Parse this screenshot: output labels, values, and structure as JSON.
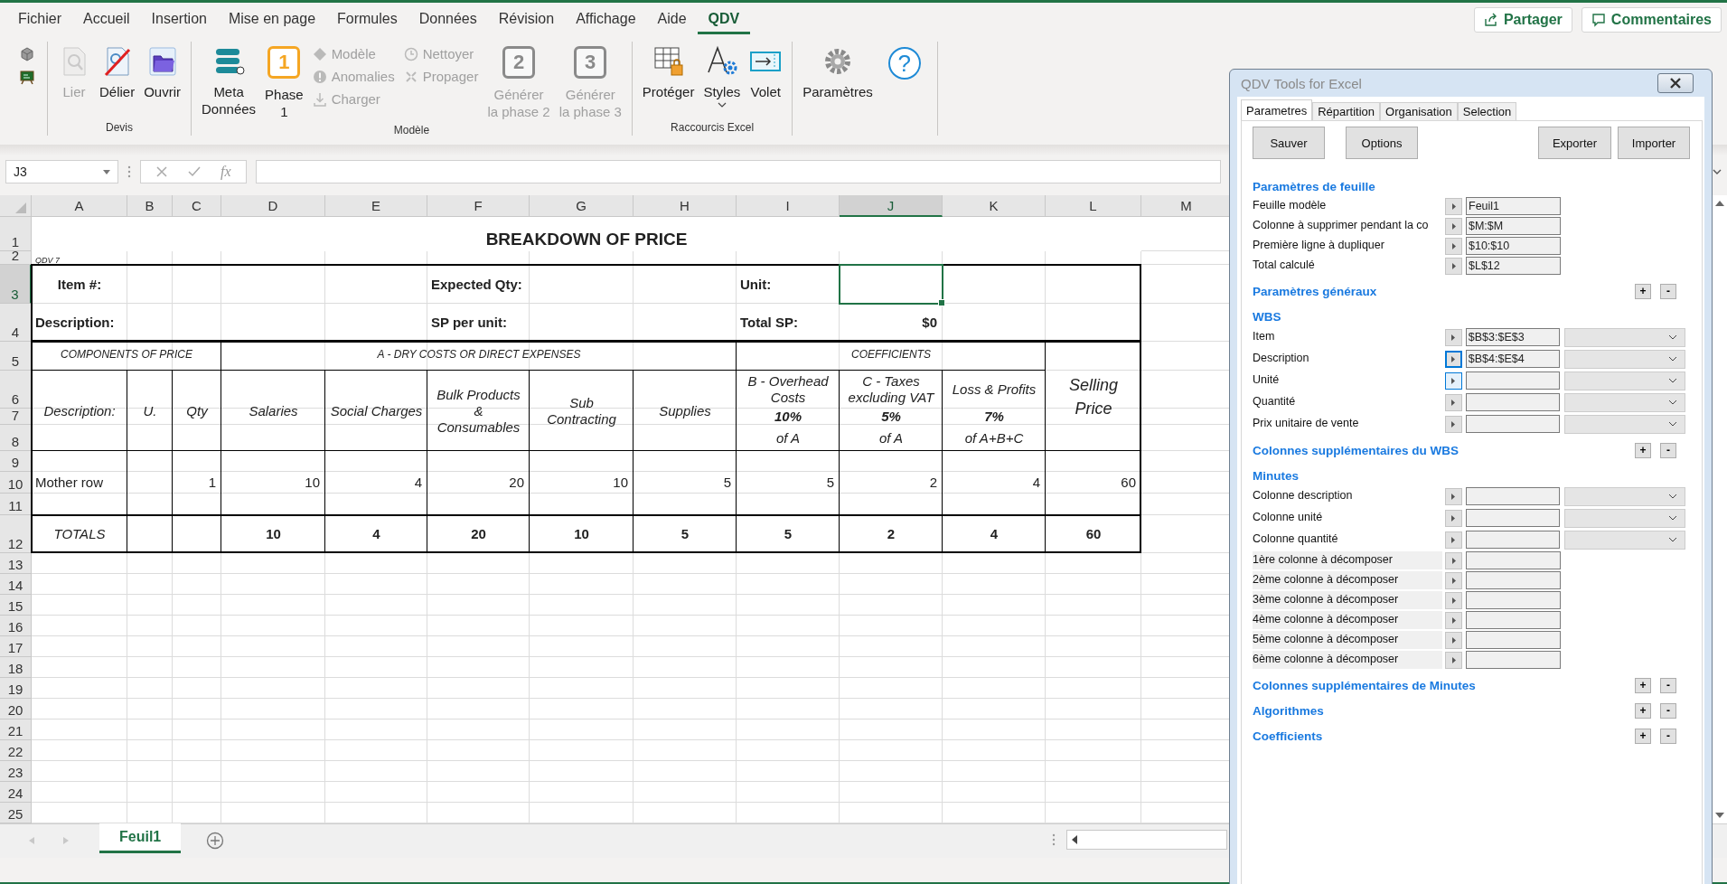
{
  "app_tabs": [
    {
      "label": "Fichier",
      "selected": false
    },
    {
      "label": "Accueil",
      "selected": false
    },
    {
      "label": "Insertion",
      "selected": false
    },
    {
      "label": "Mise en page",
      "selected": false
    },
    {
      "label": "Formules",
      "selected": false
    },
    {
      "label": "Données",
      "selected": false
    },
    {
      "label": "Révision",
      "selected": false
    },
    {
      "label": "Affichage",
      "selected": false
    },
    {
      "label": "Aide",
      "selected": false
    },
    {
      "label": "QDV",
      "selected": true
    }
  ],
  "share_button": "Partager",
  "comments_button": "Commentaires",
  "ribbon": {
    "groups": [
      {
        "label": "Devis",
        "columns": [
          {
            "kind": "large",
            "label": "Lier",
            "disabled": true,
            "menu": false
          },
          {
            "kind": "large",
            "label": "Délier",
            "disabled": false,
            "menu": false
          },
          {
            "kind": "large",
            "label": "Ouvrir",
            "disabled": false,
            "menu": false
          }
        ]
      },
      {
        "label": "Modèle",
        "columns": [
          {
            "kind": "large",
            "label": "Meta\nDonnées",
            "disabled": false,
            "menu": false
          },
          {
            "kind": "large",
            "label": "Phase\n1",
            "badge": "1",
            "disabled": false,
            "menu": false
          },
          {
            "kind": "stack",
            "items": [
              {
                "label": "Modèle",
                "disabled": true
              },
              {
                "label": "Anomalies",
                "disabled": true
              },
              {
                "label": "Charger",
                "disabled": true
              }
            ]
          },
          {
            "kind": "stack",
            "items": [
              {
                "label": "Nettoyer",
                "disabled": true
              },
              {
                "label": "Propager",
                "disabled": true
              }
            ]
          },
          {
            "kind": "large",
            "label": "Générer\nla phase 2",
            "badge": "2",
            "disabled": true,
            "menu": false
          },
          {
            "kind": "large",
            "label": "Générer\nla phase 3",
            "badge": "3",
            "disabled": true,
            "menu": false
          }
        ]
      },
      {
        "label": "Raccourcis Excel",
        "columns": [
          {
            "kind": "large",
            "label": "Protéger",
            "disabled": false,
            "menu": false
          },
          {
            "kind": "large",
            "label": "Styles",
            "disabled": false,
            "menu": true
          },
          {
            "kind": "large",
            "label": "Volet",
            "disabled": false,
            "menu": false
          }
        ]
      },
      {
        "columns": [
          {
            "kind": "large",
            "label": "Paramètres",
            "disabled": false,
            "menu": false
          },
          {
            "kind": "help",
            "glyph": "?"
          }
        ]
      }
    ]
  },
  "formula_bar": {
    "name_box": "J3",
    "function_glyph": "fx"
  },
  "sheet": {
    "columns": [
      {
        "label": "A",
        "selected": false
      },
      {
        "label": "B",
        "selected": false
      },
      {
        "label": "C",
        "selected": false
      },
      {
        "label": "D",
        "selected": false
      },
      {
        "label": "E",
        "selected": false
      },
      {
        "label": "F",
        "selected": false
      },
      {
        "label": "G",
        "selected": false
      },
      {
        "label": "H",
        "selected": false
      },
      {
        "label": "I",
        "selected": false
      },
      {
        "label": "J",
        "selected": true
      },
      {
        "label": "K",
        "selected": false
      },
      {
        "label": "L",
        "selected": false
      },
      {
        "label": "M",
        "selected": false
      }
    ],
    "rows": [
      {
        "label": "1",
        "selected": false
      },
      {
        "label": "2",
        "selected": false
      },
      {
        "label": "3",
        "selected": true
      },
      {
        "label": "4",
        "selected": false
      },
      {
        "label": "5",
        "selected": false
      },
      {
        "label": "6",
        "selected": false
      },
      {
        "label": "7",
        "selected": false
      },
      {
        "label": "8",
        "selected": false
      },
      {
        "label": "9",
        "selected": false
      },
      {
        "label": "10",
        "selected": false
      },
      {
        "label": "11",
        "selected": false
      },
      {
        "label": "12",
        "selected": false
      },
      {
        "label": "13",
        "selected": false
      },
      {
        "label": "14",
        "selected": false
      },
      {
        "label": "15",
        "selected": false
      },
      {
        "label": "16",
        "selected": false
      },
      {
        "label": "17",
        "selected": false
      },
      {
        "label": "18",
        "selected": false
      },
      {
        "label": "19",
        "selected": false
      },
      {
        "label": "20",
        "selected": false
      },
      {
        "label": "21",
        "selected": false
      },
      {
        "label": "22",
        "selected": false
      },
      {
        "label": "23",
        "selected": false
      },
      {
        "label": "24",
        "selected": false
      },
      {
        "label": "25",
        "selected": false
      }
    ],
    "title": "BREAKDOWN OF PRICE",
    "version": "QDV 7",
    "info_labels": [
      "Item #:",
      "Expected Qty:",
      "Unit:",
      "Description:",
      "SP per unit:",
      "Total SP:"
    ],
    "total_sp": "$0",
    "groups": [
      "COMPONENTS OF PRICE",
      "A - DRY COSTS OR DIRECT EXPENSES",
      "COEFFICIENTS"
    ],
    "selling_price": "Selling\nPrice",
    "headers": [
      "Description:",
      "U.",
      "Qty",
      "Salaries",
      "Social Charges",
      "Bulk Products\n&\nConsumables",
      "Sub\nContracting",
      "Supplies",
      "B - Overhead\nCosts",
      "C - Taxes\nexcluding VAT",
      "Loss & Profits"
    ],
    "rates": [
      {
        "rate": "10%",
        "basis": "of A"
      },
      {
        "rate": "5%",
        "basis": "of A"
      },
      {
        "rate": "7%",
        "basis": "of A+B+C"
      }
    ],
    "data_row": {
      "description": "Mother row",
      "qty": "1",
      "values": [
        "10",
        "4",
        "20",
        "10",
        "5",
        "5",
        "2",
        "4",
        "60"
      ]
    },
    "totals": {
      "label": "TOTALS",
      "values": [
        "10",
        "4",
        "20",
        "10",
        "5",
        "5",
        "2",
        "4",
        "60"
      ]
    }
  },
  "sheet_tabs": [
    {
      "label": "Feuil1",
      "selected": true
    }
  ],
  "panel": {
    "title": "QDV Tools for Excel",
    "tabs": [
      {
        "label": "Parametres",
        "selected": true
      },
      {
        "label": "Répartition",
        "selected": false
      },
      {
        "label": "Organisation",
        "selected": false
      },
      {
        "label": "Selection",
        "selected": false
      }
    ],
    "buttons": [
      "Sauver",
      "Options",
      "Exporter",
      "Importer"
    ],
    "sections": [
      {
        "title": "Paramètres de feuille",
        "rows": [
          {
            "kind": "ref",
            "label": "Feuille modèle",
            "value": "Feuil1",
            "focused": false,
            "hovered": false
          },
          {
            "kind": "ref",
            "label": "Colonne à supprimer pendant la co",
            "value": "$M:$M",
            "focused": false,
            "hovered": false
          },
          {
            "kind": "ref",
            "label": "Première ligne à dupliquer",
            "value": "$10:$10",
            "focused": false,
            "hovered": false
          },
          {
            "kind": "ref",
            "label": "Total calculé",
            "value": "$L$12",
            "focused": false,
            "hovered": false
          }
        ]
      },
      {
        "title": "Paramètres généraux",
        "buttons": [
          "+",
          "-"
        ]
      },
      {
        "title": "WBS",
        "rows": [
          {
            "kind": "ref-dropdown",
            "label": "Item",
            "value": "$B$3:$E$3",
            "focused": false,
            "hovered": false
          },
          {
            "kind": "ref-dropdown",
            "label": "Description",
            "value": "$B$4:$E$4",
            "focused": true,
            "hovered": false
          },
          {
            "kind": "ref-dropdown",
            "label": "Unité",
            "focused": false,
            "hovered": true
          },
          {
            "kind": "ref-dropdown",
            "label": "Quantité",
            "focused": false,
            "hovered": false
          },
          {
            "kind": "ref-dropdown",
            "label": "Prix unitaire de vente",
            "focused": false,
            "hovered": false
          }
        ]
      },
      {
        "title": "Colonnes supplémentaires du WBS",
        "buttons": [
          "+",
          "-"
        ]
      },
      {
        "title": "Minutes",
        "rows": [
          {
            "kind": "ref-dropdown",
            "label": "Colonne description",
            "focused": false,
            "hovered": false
          },
          {
            "kind": "ref-dropdown",
            "label": "Colonne unité",
            "focused": false,
            "hovered": false
          },
          {
            "kind": "ref-dropdown",
            "label": "Colonne quantité",
            "focused": false,
            "hovered": false
          },
          {
            "kind": "shaded",
            "label": "1ère colonne à décomposer",
            "focused": false,
            "hovered": false
          },
          {
            "kind": "shaded",
            "label": "2ème colonne à décomposer",
            "focused": false,
            "hovered": false
          },
          {
            "kind": "shaded",
            "label": "3ème colonne à décomposer",
            "focused": false,
            "hovered": false
          },
          {
            "kind": "shaded",
            "label": "4ème colonne à décomposer",
            "focused": false,
            "hovered": false
          },
          {
            "kind": "shaded",
            "label": "5ème colonne à décomposer",
            "focused": false,
            "hovered": false
          },
          {
            "kind": "shaded",
            "label": "6ème colonne à décomposer",
            "focused": false,
            "hovered": false
          }
        ]
      },
      {
        "title": "Colonnes supplémentaires de Minutes",
        "buttons": [
          "+",
          "-"
        ]
      },
      {
        "title": "Algorithmes",
        "buttons": [
          "+",
          "-"
        ]
      },
      {
        "title": "Coefficients",
        "buttons": [
          "+",
          "-"
        ]
      }
    ]
  }
}
